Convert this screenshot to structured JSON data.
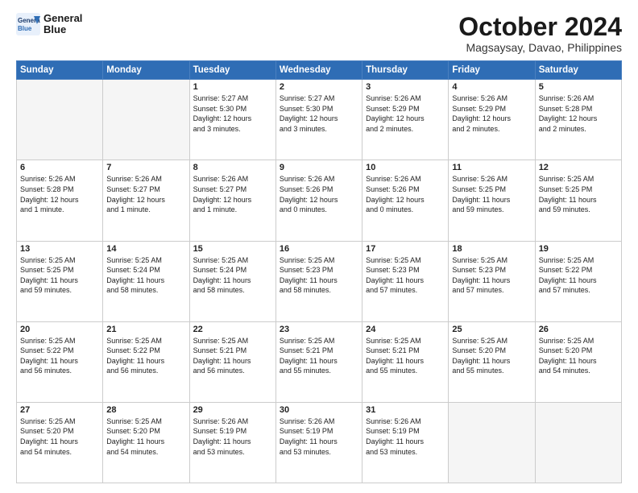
{
  "header": {
    "logo_line1": "General",
    "logo_line2": "Blue",
    "month": "October 2024",
    "location": "Magsaysay, Davao, Philippines"
  },
  "days_of_week": [
    "Sunday",
    "Monday",
    "Tuesday",
    "Wednesday",
    "Thursday",
    "Friday",
    "Saturday"
  ],
  "weeks": [
    [
      {
        "day": "",
        "info": ""
      },
      {
        "day": "",
        "info": ""
      },
      {
        "day": "1",
        "info": "Sunrise: 5:27 AM\nSunset: 5:30 PM\nDaylight: 12 hours\nand 3 minutes."
      },
      {
        "day": "2",
        "info": "Sunrise: 5:27 AM\nSunset: 5:30 PM\nDaylight: 12 hours\nand 3 minutes."
      },
      {
        "day": "3",
        "info": "Sunrise: 5:26 AM\nSunset: 5:29 PM\nDaylight: 12 hours\nand 2 minutes."
      },
      {
        "day": "4",
        "info": "Sunrise: 5:26 AM\nSunset: 5:29 PM\nDaylight: 12 hours\nand 2 minutes."
      },
      {
        "day": "5",
        "info": "Sunrise: 5:26 AM\nSunset: 5:28 PM\nDaylight: 12 hours\nand 2 minutes."
      }
    ],
    [
      {
        "day": "6",
        "info": "Sunrise: 5:26 AM\nSunset: 5:28 PM\nDaylight: 12 hours\nand 1 minute."
      },
      {
        "day": "7",
        "info": "Sunrise: 5:26 AM\nSunset: 5:27 PM\nDaylight: 12 hours\nand 1 minute."
      },
      {
        "day": "8",
        "info": "Sunrise: 5:26 AM\nSunset: 5:27 PM\nDaylight: 12 hours\nand 1 minute."
      },
      {
        "day": "9",
        "info": "Sunrise: 5:26 AM\nSunset: 5:26 PM\nDaylight: 12 hours\nand 0 minutes."
      },
      {
        "day": "10",
        "info": "Sunrise: 5:26 AM\nSunset: 5:26 PM\nDaylight: 12 hours\nand 0 minutes."
      },
      {
        "day": "11",
        "info": "Sunrise: 5:26 AM\nSunset: 5:25 PM\nDaylight: 11 hours\nand 59 minutes."
      },
      {
        "day": "12",
        "info": "Sunrise: 5:25 AM\nSunset: 5:25 PM\nDaylight: 11 hours\nand 59 minutes."
      }
    ],
    [
      {
        "day": "13",
        "info": "Sunrise: 5:25 AM\nSunset: 5:25 PM\nDaylight: 11 hours\nand 59 minutes."
      },
      {
        "day": "14",
        "info": "Sunrise: 5:25 AM\nSunset: 5:24 PM\nDaylight: 11 hours\nand 58 minutes."
      },
      {
        "day": "15",
        "info": "Sunrise: 5:25 AM\nSunset: 5:24 PM\nDaylight: 11 hours\nand 58 minutes."
      },
      {
        "day": "16",
        "info": "Sunrise: 5:25 AM\nSunset: 5:23 PM\nDaylight: 11 hours\nand 58 minutes."
      },
      {
        "day": "17",
        "info": "Sunrise: 5:25 AM\nSunset: 5:23 PM\nDaylight: 11 hours\nand 57 minutes."
      },
      {
        "day": "18",
        "info": "Sunrise: 5:25 AM\nSunset: 5:23 PM\nDaylight: 11 hours\nand 57 minutes."
      },
      {
        "day": "19",
        "info": "Sunrise: 5:25 AM\nSunset: 5:22 PM\nDaylight: 11 hours\nand 57 minutes."
      }
    ],
    [
      {
        "day": "20",
        "info": "Sunrise: 5:25 AM\nSunset: 5:22 PM\nDaylight: 11 hours\nand 56 minutes."
      },
      {
        "day": "21",
        "info": "Sunrise: 5:25 AM\nSunset: 5:22 PM\nDaylight: 11 hours\nand 56 minutes."
      },
      {
        "day": "22",
        "info": "Sunrise: 5:25 AM\nSunset: 5:21 PM\nDaylight: 11 hours\nand 56 minutes."
      },
      {
        "day": "23",
        "info": "Sunrise: 5:25 AM\nSunset: 5:21 PM\nDaylight: 11 hours\nand 55 minutes."
      },
      {
        "day": "24",
        "info": "Sunrise: 5:25 AM\nSunset: 5:21 PM\nDaylight: 11 hours\nand 55 minutes."
      },
      {
        "day": "25",
        "info": "Sunrise: 5:25 AM\nSunset: 5:20 PM\nDaylight: 11 hours\nand 55 minutes."
      },
      {
        "day": "26",
        "info": "Sunrise: 5:25 AM\nSunset: 5:20 PM\nDaylight: 11 hours\nand 54 minutes."
      }
    ],
    [
      {
        "day": "27",
        "info": "Sunrise: 5:25 AM\nSunset: 5:20 PM\nDaylight: 11 hours\nand 54 minutes."
      },
      {
        "day": "28",
        "info": "Sunrise: 5:25 AM\nSunset: 5:20 PM\nDaylight: 11 hours\nand 54 minutes."
      },
      {
        "day": "29",
        "info": "Sunrise: 5:26 AM\nSunset: 5:19 PM\nDaylight: 11 hours\nand 53 minutes."
      },
      {
        "day": "30",
        "info": "Sunrise: 5:26 AM\nSunset: 5:19 PM\nDaylight: 11 hours\nand 53 minutes."
      },
      {
        "day": "31",
        "info": "Sunrise: 5:26 AM\nSunset: 5:19 PM\nDaylight: 11 hours\nand 53 minutes."
      },
      {
        "day": "",
        "info": ""
      },
      {
        "day": "",
        "info": ""
      }
    ]
  ]
}
